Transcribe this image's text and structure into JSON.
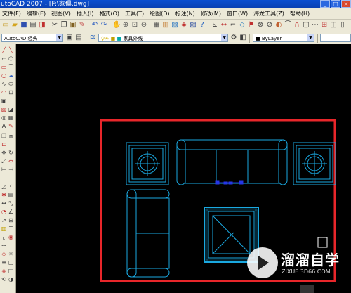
{
  "title": "utoCAD 2007 - [F:\\家俱.dwg]",
  "menu": [
    "文件(F)",
    "编辑(E)",
    "视图(V)",
    "插入(I)",
    "格式(O)",
    "工具(T)",
    "绘图(D)",
    "标注(N)",
    "修改(M)",
    "窗口(W)",
    "海龙工具(Z)",
    "帮助(H)"
  ],
  "workspace_combo": "AutoCAD 经典",
  "layer_combo": "家具外线",
  "color_combo": "ByLayer",
  "icons": [
    "new-icon",
    "open-icon",
    "save-icon",
    "print-icon",
    "cut-icon",
    "copy-icon",
    "paste-icon",
    "undo-icon",
    "redo-icon",
    "pan-icon",
    "zoom-icon",
    "properties-icon",
    "help-icon"
  ],
  "watermark": {
    "name": "溜溜自学",
    "url": "ZIXUE.3D66.COM"
  },
  "colors": {
    "outline": "#e8262a",
    "furniture": "#1aa8e0",
    "background": "#000000",
    "grip": "#2536e6"
  }
}
